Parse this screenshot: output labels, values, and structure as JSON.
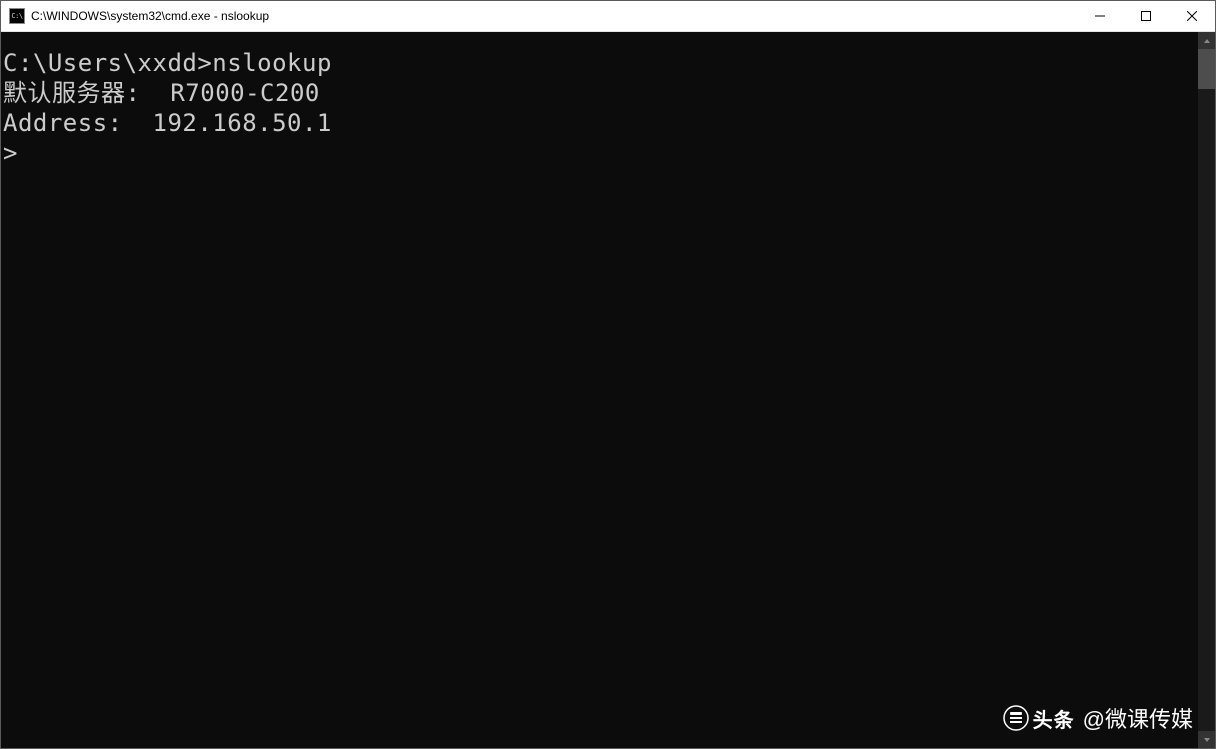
{
  "window": {
    "title": "C:\\WINDOWS\\system32\\cmd.exe - nslookup",
    "icon_label": "cmd-icon"
  },
  "terminal": {
    "line1_prompt": "C:\\Users\\xxdd>",
    "line1_command": "nslookup",
    "line2": "默认服务器:  R7000-C200",
    "line3": "Address:  192.168.50.1",
    "line4": "",
    "line5_prompt": "> "
  },
  "watermark": {
    "logo_text": "头条",
    "handle": "@微课传媒"
  }
}
